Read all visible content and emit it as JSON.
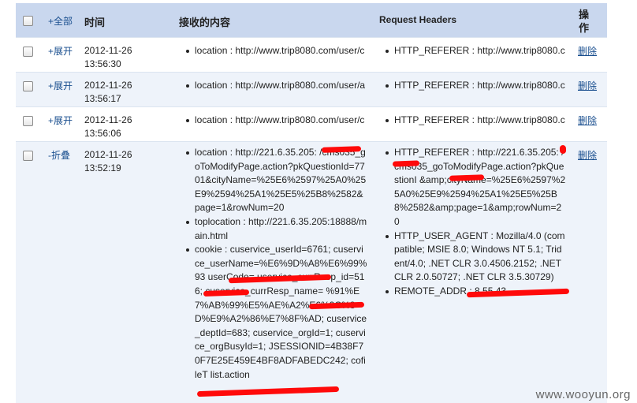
{
  "header": {
    "select_all": "+全部",
    "time": "时间",
    "content": "接收的内容",
    "request_headers": "Request Headers",
    "actions": "操\n作"
  },
  "rows": [
    {
      "toggle": "+展开",
      "date": "2012-11-26",
      "time": "13:56:30",
      "content": [
        "location : http://www.trip8080.com/user/c"
      ],
      "headers": [
        "HTTP_REFERER : http://www.trip8080.c"
      ],
      "delete": "删除"
    },
    {
      "toggle": "+展开",
      "date": "2012-11-26",
      "time": "13:56:17",
      "content": [
        "location : http://www.trip8080.com/user/a"
      ],
      "headers": [
        "HTTP_REFERER : http://www.trip8080.c"
      ],
      "delete": "删除"
    },
    {
      "toggle": "+展开",
      "date": "2012-11-26",
      "time": "13:56:06",
      "content": [
        "location : http://www.trip8080.com/user/c"
      ],
      "headers": [
        "HTTP_REFERER : http://www.trip8080.c"
      ],
      "delete": "删除"
    },
    {
      "toggle": "-折叠",
      "date": "2012-11-26",
      "time": "13:52:19",
      "content": [
        "location : http://221.6.35.205:          /cms035_goToModifyPage.action?pkQuestionId=7701&cityName=%25E6%2597%25A0%25E9%2594%25A1%25E5%25B8%2582&page=1&rowNum=20",
        "toplocation : http://221.6.35.205:18888/main.html",
        "cookie : cuservice_userId=6761; cuservice_userName=%E6%9D%A8%E6%99%93                        userCode=               uservice_currResp_id=516; cuservice_currResp_name=                 %91%E7%AB%99%E5%AE%A2%E6%9C%8D%E9%A2%86%E7%8F%AD; cuservice_deptId=683; cuservice_orgId=1; cuservice_orgBusyId=1; JSESSIONID=4B38F70F7E25E459E4BF8ADFABEDC242; cofileT                          list.action"
      ],
      "headers": [
        "HTTP_REFERER : http://221.6.35.205:          /cms035_goToModifyPage.action?pkQuestionI          &amp;cityName=%25E6%2597%25A0%25E9%2594%25A1%25E5%25B8%2582&amp;page=1&amp;rowNum=20",
        "HTTP_USER_AGENT : Mozilla/4.0 (compatible; MSIE 8.0; Windows NT 5.1; Trident/4.0; .NET CLR 3.0.4506.2152; .NET CLR 2.0.50727; .NET CLR 3.5.30729)",
        "REMOTE_ADDR :                         8.55.43"
      ],
      "delete": "删除"
    }
  ],
  "watermark": "www.wooyun.org",
  "colors": {
    "header_bg": "#c9d7ee",
    "alt_row_bg": "#eef3fa",
    "link": "#1a4f8f",
    "redaction": "#ff0a0a"
  }
}
